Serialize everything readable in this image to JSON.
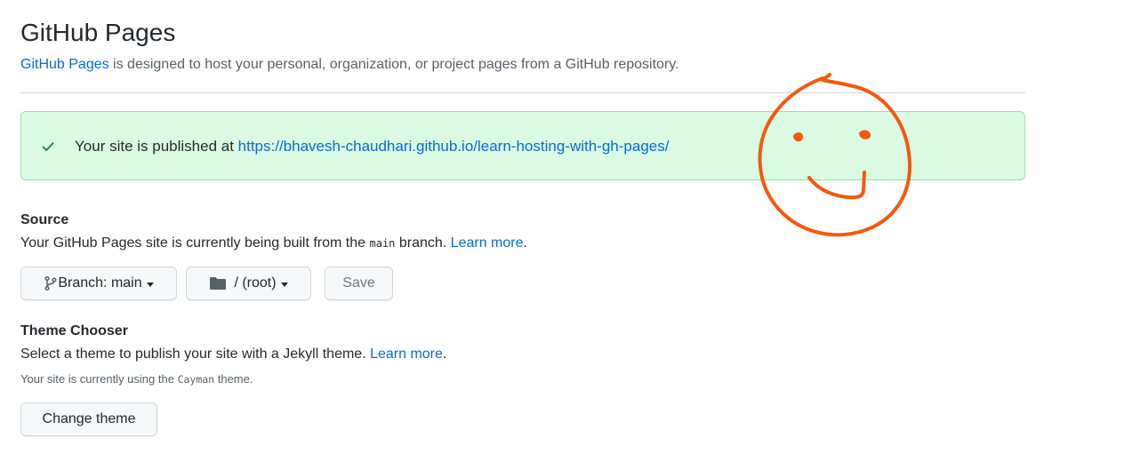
{
  "header": {
    "title": "GitHub Pages",
    "intro_link": "GitHub Pages",
    "intro_rest": " is designed to host your personal, organization, or project pages from a GitHub repository."
  },
  "flash": {
    "icon": "check-icon",
    "text": "Your site is published at ",
    "url": "https://bhavesh-chaudhari.github.io/learn-hosting-with-gh-pages/"
  },
  "source": {
    "title": "Source",
    "desc_before": "Your GitHub Pages site is currently being built from the ",
    "branch_code": "main",
    "desc_after": " branch. ",
    "learn_more": "Learn more",
    "period": ".",
    "branch_button": "Branch: main",
    "folder_button": "/ (root)",
    "save_button": "Save"
  },
  "theme": {
    "title": "Theme Chooser",
    "desc": "Select a theme to publish your site with a Jekyll theme. ",
    "learn_more": "Learn more",
    "period": ".",
    "note_before": "Your site is currently using the ",
    "note_code": "Cayman",
    "note_after": " theme.",
    "change_button": "Change theme"
  },
  "colors": {
    "link": "#0969da",
    "flash_bg": "#dafbe1",
    "check": "#1a7f37",
    "annotation": "#f25a0f"
  }
}
